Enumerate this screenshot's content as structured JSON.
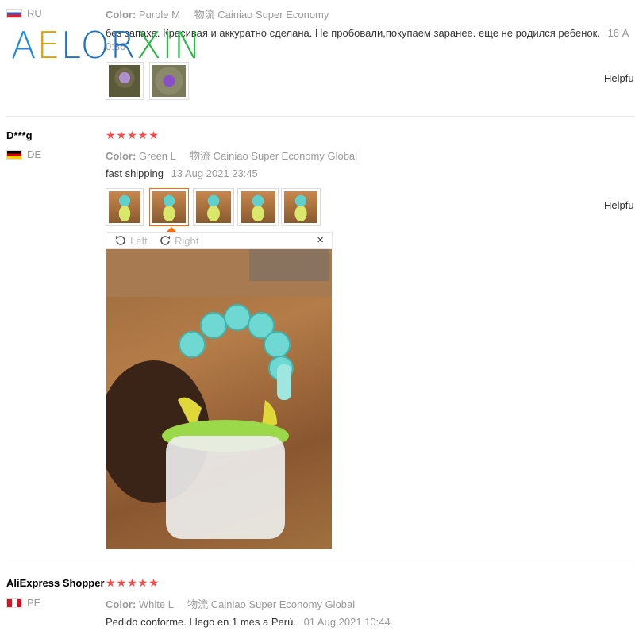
{
  "brand": {
    "logo_text": "AELORXIN"
  },
  "reviews": [
    {
      "country": "RU",
      "color_label": "Color:",
      "color_value": "Purple M",
      "shipping_label": "物流",
      "shipping_value": "Cainiao Super Economy",
      "text": "без запаха. Красивая и аккуратно сделана. Не пробовали,покупаем заранее. еще не родился ребенок.",
      "date_part1": "16 A",
      "date_part2": "0:36",
      "helpful": "Helpfu"
    },
    {
      "user": "D***g",
      "country": "DE",
      "stars": "★★★★★",
      "color_label": "Color:",
      "color_value": "Green L",
      "shipping_label": "物流",
      "shipping_value": "Cainiao Super Economy Global",
      "text": "fast shipping",
      "date": "13 Aug 2021 23:45",
      "helpful": "Helpfu",
      "viewer": {
        "left_label": "Left",
        "right_label": "Right",
        "close": "×"
      }
    },
    {
      "user": "AliExpress Shopper",
      "country": "PE",
      "stars": "★★★★★",
      "color_label": "Color:",
      "color_value": "White L",
      "shipping_label": "物流",
      "shipping_value": "Cainiao Super Economy Global",
      "text": "Pedido conforme. Llego en 1 mes a Perú.",
      "date": "01 Aug 2021 10:44"
    }
  ],
  "colors": {
    "star": "#ff4747",
    "accent": "#ff6a00"
  }
}
